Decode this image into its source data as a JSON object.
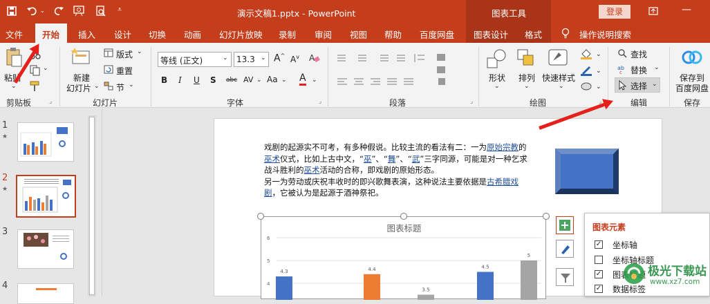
{
  "titlebar": {
    "filename": "演示文稿1.pptx",
    "separator": "-",
    "app": "PowerPoint",
    "context_tools": "图表工具",
    "login": "登录"
  },
  "tabs": [
    "文件",
    "开始",
    "插入",
    "设计",
    "切换",
    "动画",
    "幻灯片放映",
    "录制",
    "审阅",
    "视图",
    "帮助",
    "百度网盘",
    "图表设计",
    "格式"
  ],
  "tell_me": "操作说明搜索",
  "ribbon": {
    "clipboard": {
      "paste": "粘贴",
      "group": "剪贴板"
    },
    "slides": {
      "new_slide_1": "新建",
      "new_slide_2": "幻灯片",
      "layout": "版式",
      "reset": "重置",
      "section": "节",
      "group": "幻灯片"
    },
    "font": {
      "name": "等线 (正文)",
      "size": "13.3",
      "group": "字体"
    },
    "paragraph": {
      "group": "段落"
    },
    "drawing": {
      "shape": "形状",
      "arrange": "排列",
      "quick_styles": "快速样式",
      "group": "绘图"
    },
    "editing": {
      "find": "查找",
      "replace": "替换",
      "select": "选择",
      "group": "编辑"
    },
    "save": {
      "label_1": "保存到",
      "label_2": "百度网盘",
      "group": "保存"
    }
  },
  "thumbnails": [
    {
      "number": "1",
      "star": "★"
    },
    {
      "number": "2",
      "star": "★"
    },
    {
      "number": "3",
      "star": ""
    },
    {
      "number": "4",
      "star": ""
    }
  ],
  "slide": {
    "paragraph1": [
      {
        "t": "戏剧的起源实不可考，有多种假说。比较主流的看法有二：一为"
      },
      {
        "t": "原始宗教",
        "link": true
      },
      {
        "t": "的"
      },
      {
        "t": "巫术",
        "link": true
      },
      {
        "t": "仪式，比如上古中文，“"
      },
      {
        "t": "巫",
        "link": true
      },
      {
        "t": "”、“"
      },
      {
        "t": "舞",
        "link": true
      },
      {
        "t": "”、“"
      },
      {
        "t": "武",
        "link": true
      },
      {
        "t": "”三字同源，可能是对一种乞求战斗胜利的"
      },
      {
        "t": "巫术",
        "link": true
      },
      {
        "t": "活动的合称，即戏剧的原始形态。"
      }
    ],
    "paragraph2": [
      {
        "t": "另一为劳动或庆祝丰收时的即兴歌舞表演，这种说法主要依据是"
      },
      {
        "t": "古希腊戏剧",
        "link": true
      },
      {
        "t": "，它被认为是起源于酒神祭祀。"
      }
    ]
  },
  "chart_data": {
    "type": "bar",
    "title": "图表标题",
    "yticks": [
      "6",
      "5",
      "4"
    ],
    "ylim": [
      3.5,
      6
    ],
    "series_colors": [
      "#4472c4",
      "#ed7d31",
      "#a5a5a5"
    ],
    "bars": [
      {
        "value": 4.3,
        "label": "4.3",
        "color": "#4472c4"
      },
      {
        "value": 4.4,
        "label": "4.4",
        "color": "#ed7d31"
      },
      {
        "value": 3.5,
        "label": "3.5",
        "color": "#a5a5a5"
      },
      {
        "value": 4.5,
        "label": "4.5",
        "color": "#4472c4"
      },
      {
        "value": 5,
        "label": "5",
        "color": "#a5a5a5"
      }
    ]
  },
  "chart_elements_panel": {
    "title": "图表元素",
    "items": [
      {
        "label": "坐标轴",
        "checked": true
      },
      {
        "label": "坐标轴标题",
        "checked": false
      },
      {
        "label": "图表标题",
        "checked": true
      },
      {
        "label": "数据标签",
        "checked": true
      }
    ]
  },
  "watermark": {
    "line1": "极光下载站",
    "line2": "www.xz7.com"
  },
  "colors": {
    "accent": "#c43e1c",
    "annotation_arrow": "#e5201b",
    "panel_title": "#c43e1c"
  }
}
